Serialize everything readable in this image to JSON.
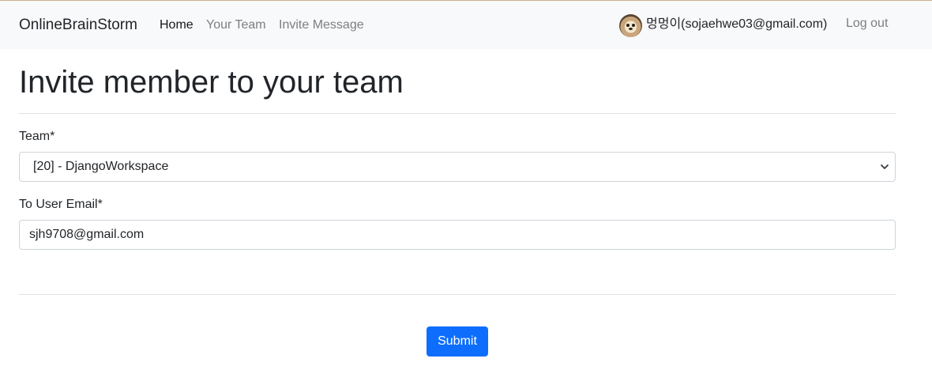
{
  "navbar": {
    "brand": "OnlineBrainStorm",
    "links": [
      {
        "label": "Home",
        "active": true
      },
      {
        "label": "Your Team",
        "active": false
      },
      {
        "label": "Invite Message",
        "active": false
      }
    ],
    "user": {
      "display": "멍멍이(sojaehwe03@gmail.com)",
      "avatar": "dog-avatar"
    },
    "logout": "Log out"
  },
  "page": {
    "title": "Invite member to your team"
  },
  "form": {
    "team": {
      "label": "Team*",
      "selected": "[20] - DjangoWorkspace",
      "icon": "chevron-down-icon"
    },
    "email": {
      "label": "To User Email*",
      "value": "sjh9708@gmail.com"
    },
    "submit_label": "Submit"
  },
  "colors": {
    "primary": "#0d6efd",
    "navbar_bg": "#f8f9fa",
    "text": "#212529",
    "muted_link": "#7c7f83"
  }
}
